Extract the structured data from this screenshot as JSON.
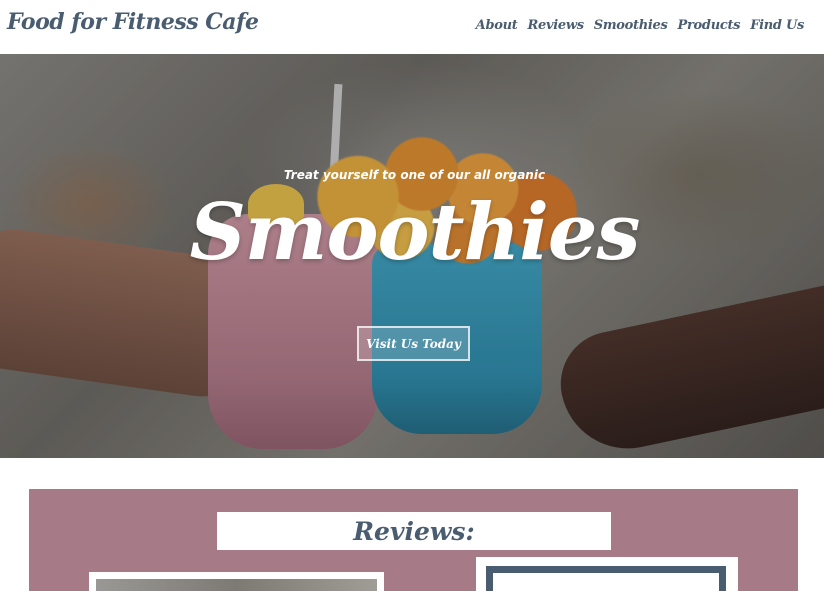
{
  "header": {
    "brand": "Food for Fitness Cafe",
    "nav": [
      "About",
      "Reviews",
      "Smoothies",
      "Products",
      "Find Us"
    ]
  },
  "hero": {
    "tagline": "Treat yourself to one of our all organic",
    "title": "Smoothies",
    "cta": "Visit Us Today"
  },
  "reviews": {
    "title": "Reviews:"
  },
  "colors": {
    "brand_text": "#4a5d70",
    "reviews_bg": "#a67b87",
    "white": "#ffffff"
  }
}
